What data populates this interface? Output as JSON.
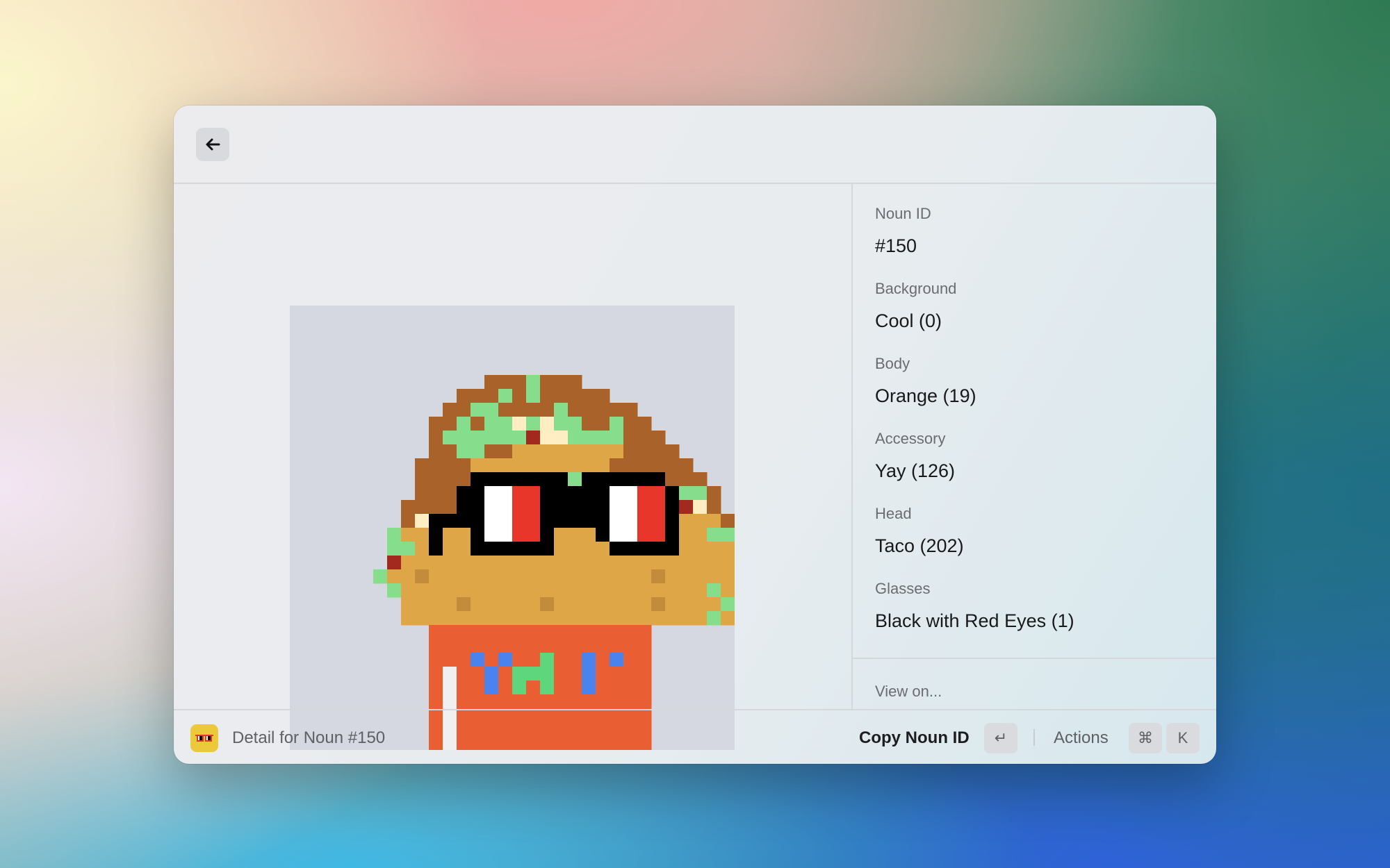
{
  "window": {
    "back_icon": "arrow-left-icon",
    "image": {
      "alt": "Noun #150",
      "background_color": "#d5d7e1",
      "grid_size": 32,
      "palette": {
        "B": "#a9622a",
        "L": "#86dd8b",
        "C": "#ffeec4",
        "R": "#a3281e",
        "T": "#dea646",
        "S": "#c38c3d",
        "K": "#000000",
        "W": "#ffffff",
        "E": "#e8372a",
        "O": "#e95e33",
        "U": "#4a83ed",
        "G": "#5ed67c",
        "P": "#f0f0f0"
      },
      "pixel_rows": [
        "................................",
        "................................",
        "................................",
        "................................",
        "................................",
        "..............BBBLBBB...........",
        "............BBBLBLBBBBB.........",
        "...........BBLLBBBBLBBBBB.......",
        "..........BBLBLLCLCLLBBLBB......",
        "..........BLLLLLLRCCLLLLBBB.....",
        "..........BBLLBBTTTTTTTTBBBB....",
        ".........BBBBTTTTTTTTTTBBBBBB...",
        ".........BBBBKKKKKKKLKKKKKKBBB..",
        ".........BBBKKWWEEKKKKKWWEEKLLB.",
        "........BBBBKKWWEEKKKKKWWEEKRCB.",
        "........BCKKKKWWEEKKKKKWWEEKTTTB",
        ".......LTTKTTKWWEEKTTTKWWEEKTTLL",
        ".......LLTKTTKKKKKKTTTTKKKKKTTTT",
        ".......RTTTTTTTTTTTTTTTTTTTTTTTT",
        "......LTTSTTTTTTTTTTTTTTTTSTTTTT",
        ".......LTTTTTTTTTTTTTTTTTTTTTTLT",
        "........TTTTSTTTTTSTTTTTTTSTTTTL",
        "........TTTTTTTTTTTTTTTTTTTTTTLT",
        "..........OOOOOOOOOOOOOOOO......",
        "..........OOOOOOOOOOOOOOOO......",
        "..........OOOUOUOOGOOUOUOO......",
        "..........OPOOUOGGGOOUOOOO......",
        "..........OPOOUOGOGOOUOOOO......",
        "..........OPOOOOOOOOOOOOOO......",
        "..........OPOOOOOOOOOOOOOO......",
        "..........OPOOOOOOOOOOOOOO......",
        "..........OPOOOOOOOOOOOOOO......"
      ]
    },
    "details": [
      {
        "label": "Noun ID",
        "value": "#150"
      },
      {
        "label": "Background",
        "value": "Cool (0)"
      },
      {
        "label": "Body",
        "value": "Orange (19)"
      },
      {
        "label": "Accessory",
        "value": "Yay (126)"
      },
      {
        "label": "Head",
        "value": "Taco (202)"
      },
      {
        "label": "Glasses",
        "value": "Black with Red Eyes (1)"
      }
    ],
    "view_on_label": "View on...",
    "bottom_bar": {
      "app_icon": "noun-glasses-icon",
      "title": "Detail for Noun #150",
      "primary_action": "Copy Noun ID",
      "enter_key": "↵",
      "actions_label": "Actions",
      "cmd_key": "⌘",
      "k_key": "K"
    }
  }
}
